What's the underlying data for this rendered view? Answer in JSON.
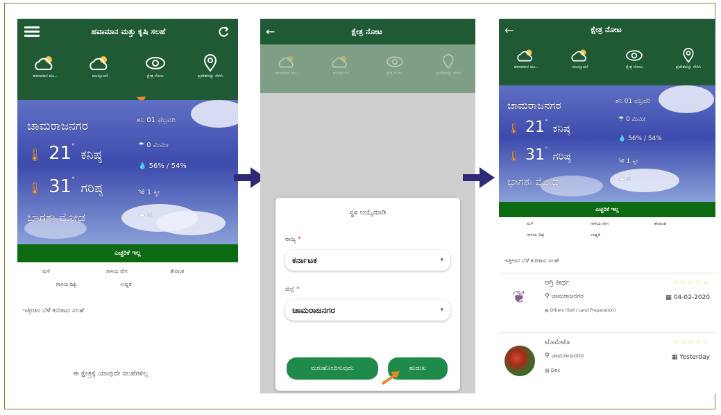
{
  "colors": {
    "app_green": "#1f5a34",
    "bar_green": "#0c6b12",
    "accent_orange": "#e9872a",
    "arrow_navy": "#2f2a78",
    "button_green": "#1f8a4a"
  },
  "screen1": {
    "title": "ಹವಾಮಾನ ಮತ್ತು ಕೃಷಿ ಸಲಹೆ",
    "tabs": [
      {
        "label": "ಹವಾಮಾನ ಮು..",
        "icon": "cloud-sun-icon"
      },
      {
        "label": "ಮುನ್ಸೂಚನೆ",
        "icon": "cloud-sun-icon"
      },
      {
        "label": "ಕ್ಷೇತ್ರ ನೋಟ",
        "icon": "eye-icon"
      },
      {
        "label": "ಪ್ರದೇಶವನ್ನು ಸೇರಿಸಿ",
        "icon": "location-pin-icon"
      }
    ],
    "weather": {
      "place": "ಚಾಮರಾಜನಗರ",
      "date": "ಶನಿ 01 ಫೆಬ್ರವರಿ",
      "min_temp": "21",
      "min_label": "ಕನಿಷ್ಠ",
      "max_temp": "31",
      "max_label": "ಗರಿಷ್ಠ",
      "condition": "ಭಾಗಶಃ ಮೋಡ",
      "rain": "0 ಮಿಮೀ",
      "humidity": "56% / 54%",
      "wind": "1 ಕ್ಮೀ",
      "cloud": "ದ"
    },
    "advisory_bar": "ಎಚ್ಚರಿಕೆ ಇಲ್ಲ",
    "legend": [
      "ಮಳೆ",
      "ಗಾಳಿಯ ವೇಗ",
      "ತೇವಾಂಶ",
      "ಗಾಳಿಯ ದಿಕ್ಕು",
      "ಉಷ್ಣತೆ"
    ],
    "section_heading": "ಇತ್ತೀಚಿನ ಬೆಳೆ ಕುರಿತಾದ ಸಲಹೆ",
    "empty_message": "ಈ ಕ್ಷೇತ್ರಕ್ಕೆ ಯಾವುದೇ ಸಲಹೆಗಳಿಲ್ಲ"
  },
  "screen2": {
    "title": "ಕ್ಷೇತ್ರ ನೋಟ",
    "tabs": [
      {
        "label": "ಹವಾಮಾನ ಮು..",
        "icon": "cloud-sun-icon"
      },
      {
        "label": "ಮುನ್ಸೂಚನೆ",
        "icon": "cloud-sun-icon"
      },
      {
        "label": "ಕ್ಷೇತ್ರ ನೋಟ",
        "icon": "eye-icon"
      },
      {
        "label": "ಪ್ರದೇಶವನ್ನು ಸೇರಿಸಿ",
        "icon": "location-pin-icon"
      }
    ],
    "dialog": {
      "title": "ಸ್ಥಳ ಆಯ್ಕೆಮಾಡಿ",
      "state_label": "ರಾಜ್ಯ",
      "state_value": "ಕರ್ನಾಟಕ",
      "district_label": "ಜಿಲ್ಲೆ",
      "district_value": "ಚಾಮರಾಜನಗರ",
      "reset_label": "ಮರುಹೊಂದಿಸುವುದು",
      "search_label": "ಹುಡುಕು"
    }
  },
  "screen3": {
    "title": "ಕ್ಷೇತ್ರ ನೋಟ",
    "tabs": [
      {
        "label": "ಹವಾಮಾನ ಮು..",
        "icon": "cloud-sun-icon"
      },
      {
        "label": "ಮುನ್ಸೂಚನೆ",
        "icon": "cloud-sun-icon"
      },
      {
        "label": "ಕ್ಷೇತ್ರ ನೋಟ",
        "icon": "eye-icon"
      },
      {
        "label": "ಪ್ರದೇಶವನ್ನು ಸೇರಿಸಿ",
        "icon": "location-pin-icon"
      }
    ],
    "weather": {
      "place": "ಚಾಮರಾಜನಗರ",
      "date": "ಶನಿ 01 ಫೆಬ್ರವರಿ",
      "min_temp": "21",
      "min_label": "ಕನಿಷ್ಠ",
      "max_temp": "31",
      "max_label": "ಗರಿಷ್ಠ",
      "condition": "ಭಾಗಶಃ ಮೋಡ",
      "rain": "0 ಮಿಮೀ",
      "humidity": "56% / 54%",
      "wind": "1 ಕ್ಮೀ",
      "cloud": "ದ"
    },
    "advisory_bar": "ಎಚ್ಚರಿಕೆ ಇಲ್ಲ",
    "legend": [
      "ಮಳೆ",
      "ಗಾಳಿಯ ವೇಗ",
      "ತೇವಾಂಶ",
      "ಗಾಳಿಯ ದಿಕ್ಕು",
      "ಉಷ್ಣತೆ"
    ],
    "section_heading": "ಇತ್ತೀಚಿನ ಬೆಳೆ ಕುರಿತಾದ ಸಲಹೆ",
    "posts": [
      {
        "title": "ಆಗ್ರಿ ತೀರ್ಥ",
        "place": "ಚಾಮರಾಜನಗರ",
        "date": "04-02-2020",
        "meta": "Others (Soil / Land Preparation)",
        "rating": 0
      },
      {
        "title": "ಟೊಮೆಟೊ",
        "place": "ಚಾಮರಾಜನಗರ",
        "date": "Yesterday",
        "meta": "Dec",
        "rating": 0
      }
    ]
  }
}
